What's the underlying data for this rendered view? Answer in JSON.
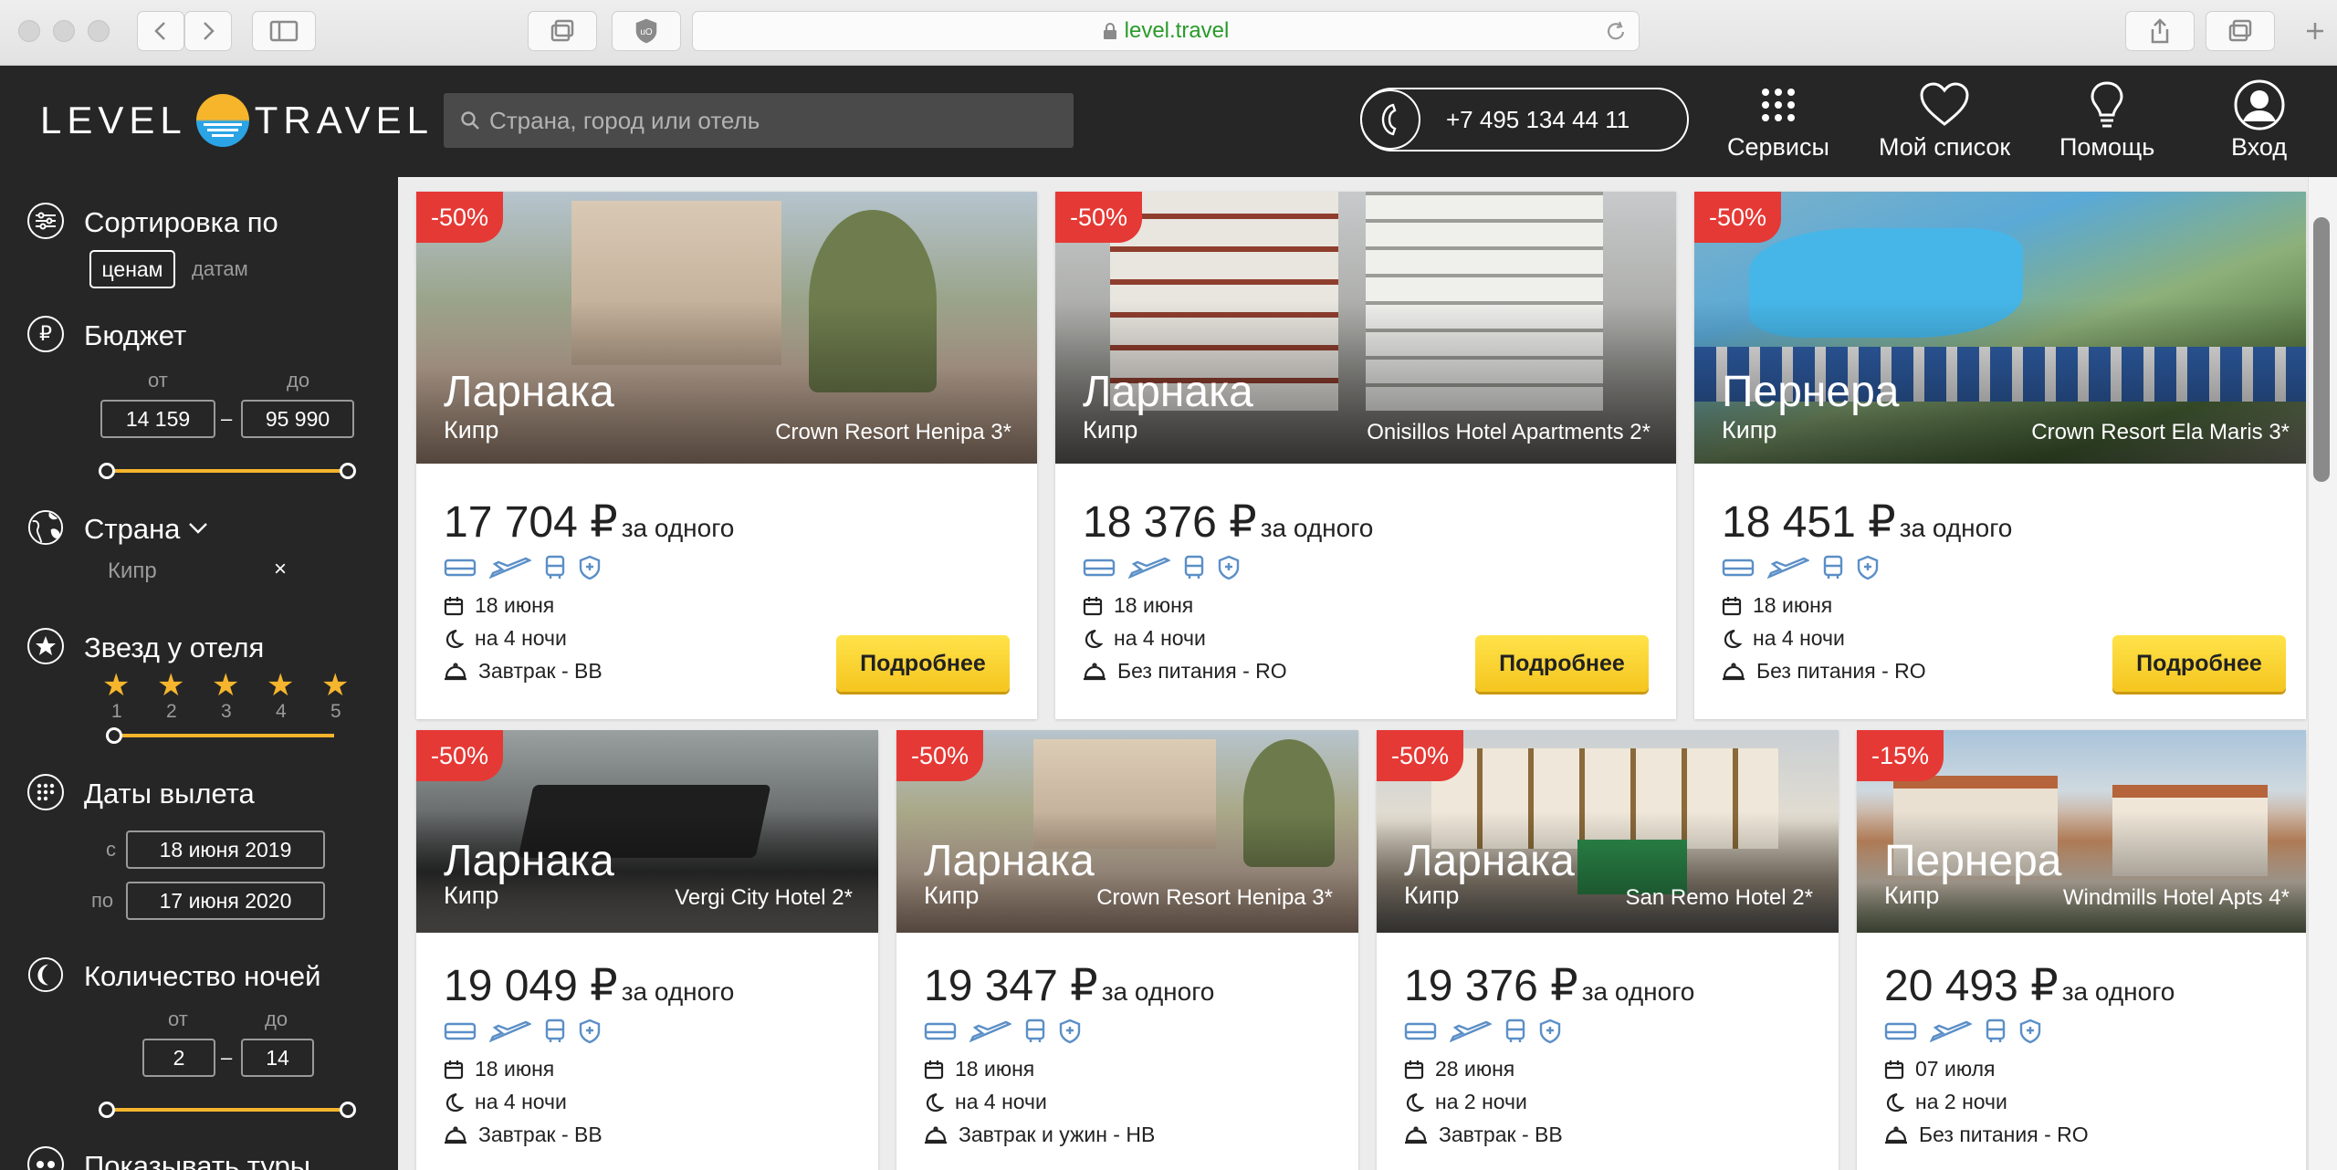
{
  "browser": {
    "url": "level.travel"
  },
  "header": {
    "logo_left": "LEVEL",
    "logo_right": "TRAVEL",
    "search_placeholder": "Страна, город или отель",
    "phone": "+7 495 134 44 11",
    "nav": [
      {
        "label": "Сервисы",
        "icon": "grid-icon"
      },
      {
        "label": "Мой список",
        "icon": "heart-icon"
      },
      {
        "label": "Помощь",
        "icon": "bulb-icon"
      },
      {
        "label": "Вход",
        "icon": "user-icon"
      }
    ]
  },
  "sidebar": {
    "sort": {
      "title": "Сортировка по",
      "option_active": "ценам",
      "option_other": "датам"
    },
    "budget": {
      "title": "Бюджет",
      "currency_icon": "₽",
      "from_label": "от",
      "to_label": "до",
      "from": "14 159",
      "to": "95 990",
      "dash": "–"
    },
    "country": {
      "title": "Страна",
      "value": "Кипр",
      "remove": "×"
    },
    "stars": {
      "title": "Звезд у отеля",
      "labels": [
        "1",
        "2",
        "3",
        "4",
        "5"
      ]
    },
    "dates": {
      "title": "Даты вылета",
      "from_label": "с",
      "to_label": "по",
      "from": "18 июня 2019",
      "to": "17 июня 2020"
    },
    "nights": {
      "title": "Количество ночей",
      "from_label": "от",
      "to_label": "до",
      "from": "2",
      "to": "14",
      "dash": "–"
    },
    "show_tours": {
      "title": "Показывать туры"
    }
  },
  "cards": [
    {
      "discount": "-50%",
      "city": "Ларнака",
      "country": "Кипр",
      "hotel": "Crown Resort Henipa 3*",
      "price": "17 704 ₽",
      "per": "за одного",
      "date": "18 июня",
      "nights": "на 4 ночи",
      "meal": "Завтрак - BB",
      "button": "Подробнее"
    },
    {
      "discount": "-50%",
      "city": "Ларнака",
      "country": "Кипр",
      "hotel": "Onisillos Hotel Apartments 2*",
      "price": "18 376 ₽",
      "per": "за одного",
      "date": "18 июня",
      "nights": "на 4 ночи",
      "meal": "Без питания - RO",
      "button": "Подробнее"
    },
    {
      "discount": "-50%",
      "city": "Пернера",
      "country": "Кипр",
      "hotel": "Crown Resort Ela Maris 3*",
      "price": "18 451 ₽",
      "per": "за одного",
      "date": "18 июня",
      "nights": "на 4 ночи",
      "meal": "Без питания - RO",
      "button": "Подробнее"
    },
    {
      "discount": "-50%",
      "city": "Ларнака",
      "country": "Кипр",
      "hotel": "Vergi City Hotel 2*",
      "price": "19 049 ₽",
      "per": "за одного",
      "date": "18 июня",
      "nights": "на 4 ночи",
      "meal": "Завтрак - BB"
    },
    {
      "discount": "-50%",
      "city": "Ларнака",
      "country": "Кипр",
      "hotel": "Crown Resort Henipa 3*",
      "price": "19 347 ₽",
      "per": "за одного",
      "date": "18 июня",
      "nights": "на 4 ночи",
      "meal": "Завтрак и ужин - HB"
    },
    {
      "discount": "-50%",
      "city": "Ларнака",
      "country": "Кипр",
      "hotel": "San Remo Hotel 2*",
      "price": "19 376 ₽",
      "per": "за одного",
      "date": "28 июня",
      "nights": "на 2 ночи",
      "meal": "Завтрак - BB"
    },
    {
      "discount": "-15%",
      "city": "Пернера",
      "country": "Кипр",
      "hotel": "Windmills Hotel Apts 4*",
      "price": "20 493 ₽",
      "per": "за одного",
      "date": "07 июля",
      "nights": "на 2 ночи",
      "meal": "Без питания - RO"
    }
  ],
  "colors": {
    "accent": "#f5b52d",
    "badge": "#e53935",
    "dark": "#262626",
    "icon_blue": "#5b8fc7"
  }
}
